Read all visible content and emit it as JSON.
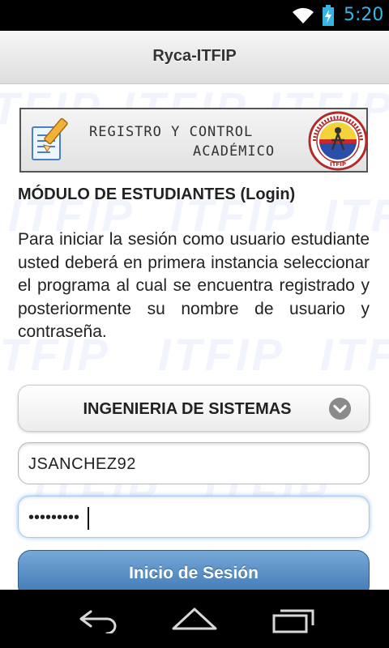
{
  "status_bar": {
    "time": "5:20",
    "icons": [
      "wifi-icon",
      "battery-charging-icon"
    ],
    "time_color": "#33b5e5"
  },
  "header": {
    "title": "Ryca-ITFIP"
  },
  "watermark_text": "ITFIP",
  "banner": {
    "line1": "REGISTRO Y CONTROL",
    "line2": "ACADÉMICO",
    "seal_text": "INSTITUCIÓN DE EDUCACIÓN SUPERIOR ITFIP"
  },
  "main": {
    "module_title": "MÓDULO DE ESTUDIANTES (Login)",
    "instructions": "Para iniciar la sesión como usuario estudiante usted deberá en primera instancia seleccionar el programa al cual se encuentra registrado y posteriormente su nombre de usuario y contraseña.",
    "program_select": {
      "selected": "INGENIERIA DE SISTEMAS"
    },
    "username": {
      "value": "JSANCHEZ92"
    },
    "password": {
      "masked_value": "•••••••••"
    },
    "login_button": "Inicio de Sesión",
    "accent_color": "#3d76b2"
  },
  "nav_bar": {
    "buttons": [
      "back-icon",
      "home-icon",
      "recent-apps-icon"
    ]
  }
}
